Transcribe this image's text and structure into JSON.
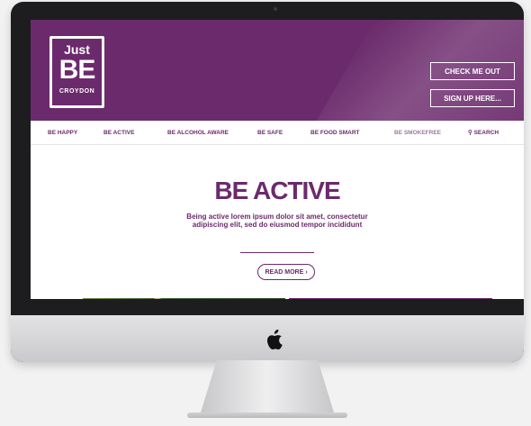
{
  "header": {
    "logo": {
      "line1": "Just",
      "line2": "BE",
      "line3": "CROYDON"
    },
    "cta_primary": "CHECK ME OUT",
    "cta_secondary": "SIGN UP HERE...",
    "brand_color": "#6b2a6c"
  },
  "nav": {
    "items": [
      {
        "label": "BE HAPPY"
      },
      {
        "label": "BE ACTIVE"
      },
      {
        "label": "BE ALCOHOL AWARE"
      },
      {
        "label": "BE SAFE"
      },
      {
        "label": "BE FOOD SMART"
      },
      {
        "label": "BE SMOKEFREE"
      }
    ],
    "search_label": "SEARCH"
  },
  "main": {
    "title": "BE ACTIVE",
    "subtitle_line1": "Being active lorem ipsum dolor sit amet, consectetur",
    "subtitle_line2": "adipiscing elit, sed do eiusmod tempor incididunt",
    "read_more": "READ MORE ›"
  }
}
